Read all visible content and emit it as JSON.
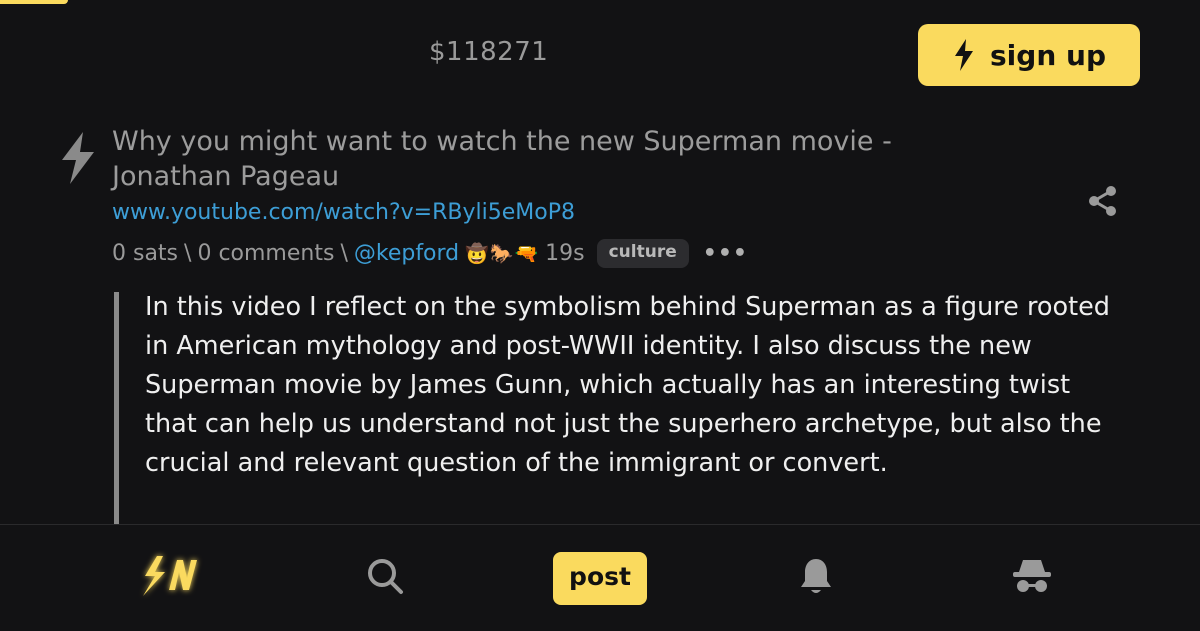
{
  "header": {
    "price": "$118271",
    "signup_label": "sign up"
  },
  "post": {
    "title": "Why you might want to watch the new Superman movie - Jonathan Pageau",
    "url": "www.youtube.com/watch?v=RByli5eMoP8",
    "sats": "0 sats",
    "comments": "0 comments",
    "sep": "\\",
    "user": "@kepford",
    "user_badges": "🤠🐎🔫",
    "age": "19s",
    "tag": "culture",
    "more": "•••",
    "body": "In this video I reflect on the symbolism behind Superman as a figure rooted in American mythology and post-WWII identity. I also discuss the new Superman movie by James Gunn, which actually has an interesting twist that can help us understand not just the superhero archetype, but also the crucial and relevant question of the immigrant or convert."
  },
  "nav": {
    "post_label": "post",
    "icons": [
      "sn-logo-icon",
      "search-icon",
      "bell-icon",
      "incognito-icon"
    ]
  },
  "colors": {
    "accent": "#fada5e",
    "link": "#3d9ed6",
    "background": "#121214"
  }
}
